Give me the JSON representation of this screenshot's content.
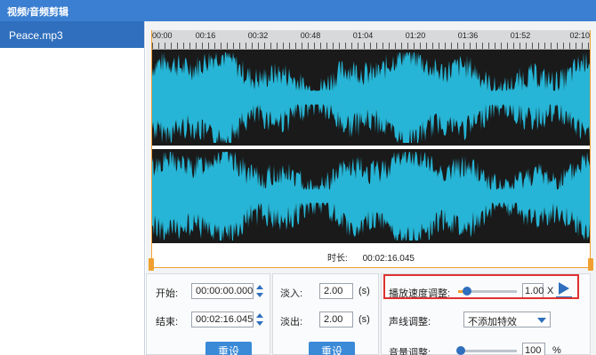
{
  "window": {
    "title": "视频/音频剪辑"
  },
  "file_list": {
    "items": [
      {
        "name": "Peace.mp3",
        "selected": true
      }
    ]
  },
  "timeline": {
    "ticks": [
      "00:00",
      "00:16",
      "00:32",
      "00:48",
      "01:04",
      "01:20",
      "01:36",
      "01:52",
      "02:10"
    ],
    "duration_label": "时长:",
    "duration_value": "00:02:16.045"
  },
  "trim": {
    "start_label": "开始:",
    "start_value": "00:00:00.000",
    "end_label": "结束:",
    "end_value": "00:02:16.045",
    "reset_label": "重设"
  },
  "fade": {
    "fade_in_label": "淡入:",
    "fade_in_value": "2.00",
    "fade_in_unit": "(s)",
    "fade_out_label": "淡出:",
    "fade_out_value": "2.00",
    "fade_out_unit": "(s)",
    "reset_label": "重设"
  },
  "adjust": {
    "speed_label": "播放速度调整:",
    "speed_value": "1.00",
    "speed_unit": "X",
    "speed_level": 0.15,
    "pitch_label": "声线调整:",
    "pitch_value": "不添加特效",
    "volume_label": "音量调整:",
    "volume_value": "100",
    "volume_unit": "%",
    "volume_level": 0.05
  },
  "colors": {
    "waveform": "#26b5d6",
    "waveform_bg": "#1a1a1a",
    "accent": "#2f6fbd",
    "trim_handles": "#f0a030",
    "highlight": "#e03030"
  },
  "icons": {
    "play": "play-icon",
    "spin": "spinner-icon",
    "dropdown": "chevron-down-icon"
  }
}
